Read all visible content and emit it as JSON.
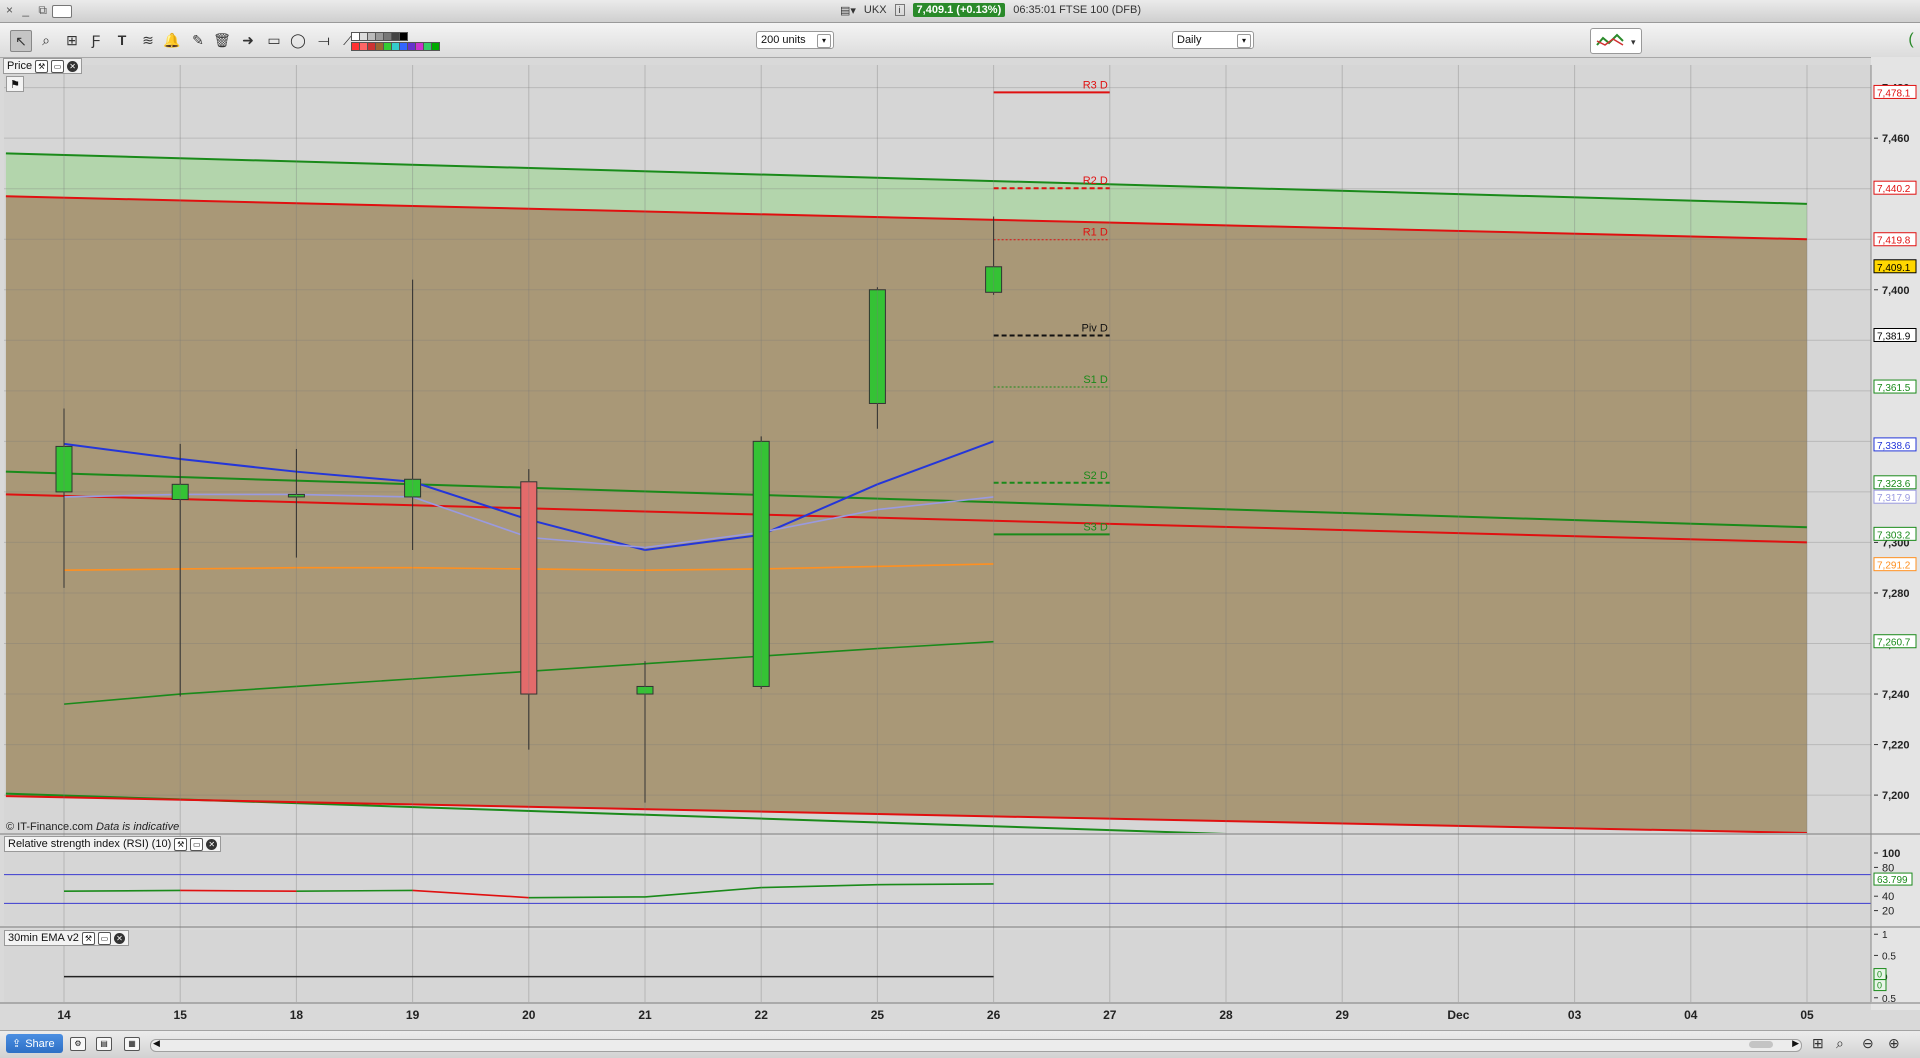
{
  "window": {
    "controls": "× _ ⧉",
    "instrument": "UKX",
    "price_badge": "7,409.1 (+0.13%)",
    "status": "06:35:01 FTSE 100 (DFB)"
  },
  "toolbar": {
    "units_select": "200 units",
    "period_select": "Daily",
    "tools": [
      "pointer-icon",
      "zoom-icon",
      "chart-type-icon",
      "fibonacci-icon",
      "text-icon",
      "parallel-lines-icon",
      "alert-icon",
      "pen-icon",
      "trash-icon",
      "arrow-icon",
      "rectangle-icon",
      "ellipse-icon",
      "horizontal-line-icon",
      "trend-line-icon"
    ],
    "colors": {
      "grays": [
        "#ffffff",
        "#dddddd",
        "#bbbbbb",
        "#999999",
        "#777777",
        "#444444",
        "#000000"
      ],
      "brights": [
        "#ff3333",
        "#ff6666",
        "#cc3333",
        "#996633",
        "#33cc33",
        "#33cccc",
        "#3366ff",
        "#6633cc",
        "#cc33cc",
        "#33cc66",
        "#00aa00"
      ]
    }
  },
  "price_panel": {
    "label": "Price",
    "copyright": "© IT-Finance.com",
    "indicative": "Data is indicative"
  },
  "rsi_panel": {
    "label": "Relative strength index (RSI) (10)",
    "value_tag": "63.799"
  },
  "ema_panel": {
    "label": "30min EMA v2",
    "value_tags": [
      "0",
      "0"
    ]
  },
  "share_label": "Share",
  "colors": {
    "bull": "#35c235",
    "bear": "#e36b6b",
    "chart_fill": "#a99877",
    "channel_green": "#1a8a1a",
    "channel_red": "#e01010",
    "blue_ma": "#2436d9",
    "lavender_ma": "#9a9ae0",
    "orange_ma": "#ff9020"
  },
  "chart_data": [
    {
      "type": "candlestick",
      "x_labels": [
        "14",
        "15",
        "18",
        "19",
        "20",
        "21",
        "22",
        "25",
        "26",
        "27",
        "28",
        "29",
        "Dec",
        "03",
        "04",
        "05"
      ],
      "ylim": [
        7185,
        7485
      ],
      "y_ticks": [
        7200,
        7220,
        7240,
        7260,
        7280,
        7300,
        7320,
        7340,
        7360,
        7380,
        7400,
        7420,
        7440,
        7460,
        7480
      ],
      "y_tick_labels": [
        "7,200",
        "7,220",
        "7,240",
        "7,260",
        "7,280",
        "7,300",
        "",
        "",
        "",
        "",
        "7,400",
        "",
        "",
        "7,460",
        "7,480"
      ],
      "candles": [
        {
          "date": "14",
          "open": 7320,
          "high": 7353,
          "low": 7282,
          "close": 7338
        },
        {
          "date": "15",
          "open": 7317,
          "high": 7339,
          "low": 7239,
          "close": 7323
        },
        {
          "date": "18",
          "open": 7318,
          "high": 7337,
          "low": 7294,
          "close": 7319
        },
        {
          "date": "19",
          "open": 7318,
          "high": 7404,
          "low": 7297,
          "close": 7325
        },
        {
          "date": "20",
          "open": 7324,
          "high": 7329,
          "low": 7218,
          "close": 7240
        },
        {
          "date": "21",
          "open": 7240,
          "high": 7253,
          "low": 7197,
          "close": 7243
        },
        {
          "date": "22",
          "open": 7243,
          "high": 7342,
          "low": 7242,
          "close": 7340
        },
        {
          "date": "25",
          "open": 7355,
          "high": 7401,
          "low": 7345,
          "close": 7400
        },
        {
          "date": "26",
          "open": 7399,
          "high": 7429,
          "low": 7398,
          "close": 7409.1
        }
      ],
      "pivots": [
        {
          "label": "R3 D",
          "value": 7478.1,
          "color": "#e01010",
          "style": "solid"
        },
        {
          "label": "R2 D",
          "value": 7440.2,
          "color": "#e01010",
          "style": "dashed"
        },
        {
          "label": "R1 D",
          "value": 7419.8,
          "color": "#e01010",
          "style": "dotted"
        },
        {
          "label": "Piv D",
          "value": 7381.9,
          "color": "#111111",
          "style": "dashed"
        },
        {
          "label": "S1 D",
          "value": 7361.5,
          "color": "#1a8a1a",
          "style": "dotted"
        },
        {
          "label": "S2 D",
          "value": 7323.6,
          "color": "#1a8a1a",
          "style": "dashed"
        },
        {
          "label": "S3 D",
          "value": 7303.2,
          "color": "#1a8a1a",
          "style": "solid"
        }
      ],
      "channel_lines": [
        {
          "name": "upper-green",
          "color": "#1a8a1a",
          "x_start": "13.5",
          "y_start": 7454,
          "x_end": "05",
          "y_end": 7434
        },
        {
          "name": "upper-red",
          "color": "#e01010",
          "x_start": "13.5",
          "y_start": 7437,
          "x_end": "05",
          "y_end": 7420
        },
        {
          "name": "mid-green",
          "color": "#1a8a1a",
          "x_start": "13.5",
          "y_start": 7328,
          "x_end": "05",
          "y_end": 7306
        },
        {
          "name": "mid-red",
          "color": "#e01010",
          "x_start": "13.5",
          "y_start": 7319,
          "x_end": "05",
          "y_end": 7300
        },
        {
          "name": "low-green",
          "color": "#1a8a1a",
          "x_start": "13.5",
          "y_start": 7200.6,
          "x_end": "05",
          "y_end": 7177
        },
        {
          "name": "low-red",
          "color": "#e01010",
          "x_start": "13.5",
          "y_start": 7199.6,
          "x_end": "05",
          "y_end": 7185
        }
      ],
      "moving_averages": [
        {
          "name": "blue",
          "color": "#2436d9",
          "values": [
            7339,
            7333,
            7328,
            7324,
            7309,
            7297,
            7303,
            7323,
            7340
          ]
        },
        {
          "name": "lavender",
          "color": "#9a9ae0",
          "values": [
            7318,
            7319,
            7319,
            7318,
            7302,
            7298,
            7304,
            7313,
            7318
          ]
        },
        {
          "name": "orange",
          "color": "#ff9020",
          "values": [
            7289,
            7289.5,
            7290,
            7290,
            7289.5,
            7289,
            7289.5,
            7290.5,
            7291.5
          ]
        },
        {
          "name": "green",
          "color": "#1a8a1a",
          "values": [
            7236,
            7240,
            7243,
            7246,
            7249,
            7252,
            7255,
            7258,
            7260.7
          ]
        }
      ],
      "price_tags": [
        {
          "value": 7478.1,
          "text": "7,478.1",
          "color": "#e01010",
          "bg": "#ffffff"
        },
        {
          "value": 7440.2,
          "text": "7,440.2",
          "color": "#e01010",
          "bg": "#ffffff"
        },
        {
          "value": 7419.8,
          "text": "7,419.8",
          "color": "#e01010",
          "bg": "#ffffff"
        },
        {
          "value": 7409.1,
          "text": "7,409.1",
          "color": "#000000",
          "bg": "#ffd700"
        },
        {
          "value": 7381.9,
          "text": "7,381.9",
          "color": "#000000",
          "bg": "#ffffff"
        },
        {
          "value": 7361.5,
          "text": "7,361.5",
          "color": "#1a8a1a",
          "bg": "#ffffff"
        },
        {
          "value": 7338.6,
          "text": "7,338.6",
          "color": "#2436d9",
          "bg": "#ffffff"
        },
        {
          "value": 7323.6,
          "text": "7,323.6",
          "color": "#1a8a1a",
          "bg": "#ffffff"
        },
        {
          "value": 7317.9,
          "text": "7,317.9",
          "color": "#9a9ae0",
          "bg": "#ffffff"
        },
        {
          "value": 7303.2,
          "text": "7,303.2",
          "color": "#1a8a1a",
          "bg": "#ffffff"
        },
        {
          "value": 7291.2,
          "text": "7,291.2",
          "color": "#ff9020",
          "bg": "#ffffff"
        },
        {
          "value": 7260.7,
          "text": "7,260.7",
          "color": "#1a8a1a",
          "bg": "#ffffff"
        }
      ]
    },
    {
      "type": "line",
      "title": "Relative strength index (RSI) (10)",
      "x": [
        "14",
        "15",
        "18",
        "19",
        "20",
        "21",
        "22",
        "25",
        "26"
      ],
      "values": [
        47,
        48,
        47,
        48,
        38,
        39,
        52,
        56,
        57
      ],
      "ylim": [
        0,
        100
      ],
      "y_ticks": [
        100,
        80,
        40,
        20
      ],
      "levels": [
        70,
        30
      ],
      "last": 63.799
    },
    {
      "type": "line",
      "title": "30min EMA v2",
      "x": [
        "14",
        "15",
        "18",
        "19",
        "20",
        "21",
        "22",
        "25",
        "26"
      ],
      "values": [
        0,
        0,
        0,
        0,
        0,
        0,
        0,
        0,
        0
      ],
      "ylim": [
        -0.6,
        1.1
      ],
      "y_ticks": [
        1,
        0.5,
        0,
        -0.5
      ],
      "y_tick_labels": [
        "1",
        "0.5",
        "0",
        "0.5"
      ]
    }
  ]
}
